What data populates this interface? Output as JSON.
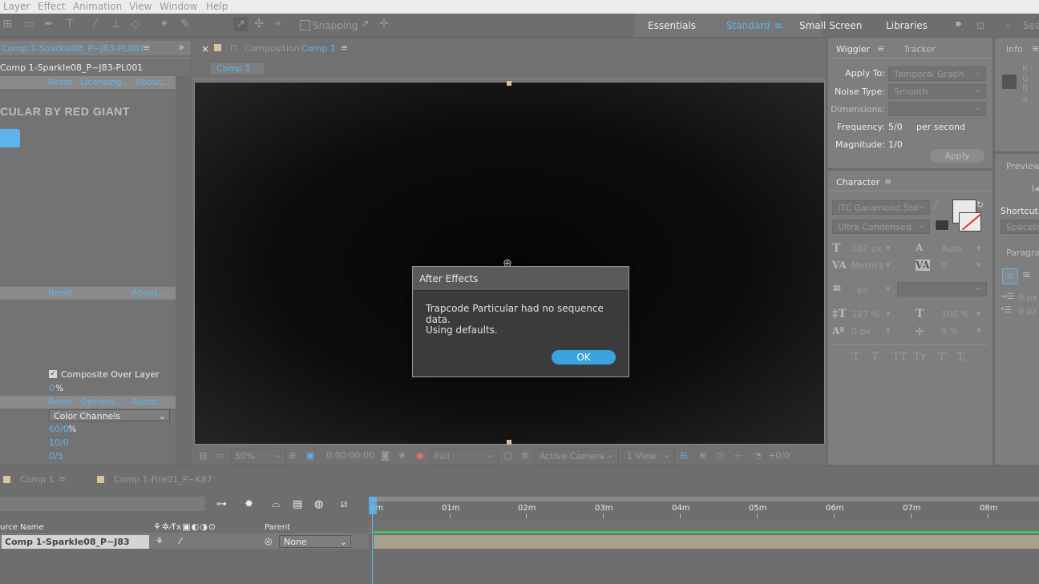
{
  "menu": [
    "Layer",
    "Effect",
    "Animation",
    "View",
    "Window",
    "Help"
  ],
  "toolbar": {
    "snapping_label": "Snapping"
  },
  "workspaces": [
    {
      "label": "Essentials",
      "active": false
    },
    {
      "label": "Standard",
      "active": true
    },
    {
      "label": "Small Screen",
      "active": false
    },
    {
      "label": "Libraries",
      "active": false
    }
  ],
  "effects_panel": {
    "tab_title": "Comp 1-Sparkle08_P~J83-PL001",
    "layer_title": "Comp 1-Sparkle08_P~J83-PL001",
    "row1": {
      "reset": "Reset",
      "licensing": "Licensing...",
      "about": "About..."
    },
    "brand": "CULAR BY RED GIANT",
    "row2": {
      "reset": "Reset",
      "about": "About..."
    },
    "composite_label": "Composite Over Layer",
    "composite_value": "0",
    "composite_unit": "%",
    "row3": {
      "reset": "Reset",
      "options": "Options...",
      "about": "About..."
    },
    "channels": "Color Channels",
    "val1": "60/0",
    "val1_unit": "%",
    "val2": "10/0",
    "val3": "0/5"
  },
  "composition": {
    "close": "×",
    "label": "Composition",
    "name": "Comp 1",
    "tab": "Comp 1",
    "zoom": "50%",
    "timecode": "0:00:00:00",
    "resolution": "Full",
    "camera": "Active Camera",
    "view": "1 View",
    "exposure": "+0/0"
  },
  "dialog": {
    "title": "After Effects",
    "line1": "Trapcode Particular had no sequence data.",
    "line2": "Using defaults.",
    "ok": "OK"
  },
  "wiggler": {
    "tab1": "Wiggler",
    "tab2": "Tracker",
    "apply_to_label": "Apply To:",
    "apply_to_value": "Temporal Graph",
    "noise_label": "Noise Type:",
    "noise_value": "Smooth",
    "dimensions_label": "Dimensions:",
    "frequency_label": "Frequency:",
    "frequency_value": "5/0",
    "frequency_unit": "per second",
    "magnitude_label": "Magnitude:",
    "magnitude_value": "1/0",
    "apply_button": "Apply"
  },
  "info_panel": {
    "tab": "Info",
    "r": "R :",
    "g": "G :",
    "b": "B :",
    "a": "A :",
    "preview": "Preview",
    "shortcut": "Shortcut",
    "shortcut_value": "Spaceba",
    "paragraph": "Paragrap",
    "indent1": "0 px",
    "indent2": "0 px"
  },
  "search_placeholder": "Sear",
  "character": {
    "tab": "Character",
    "font": "ITC Garamond Std",
    "style": "Ultra Condensed",
    "size": "102 px",
    "leading": "Auto",
    "kerning": "Metrics",
    "tracking": "0",
    "stroke": "- px",
    "vscale": "127 %",
    "hscale": "100 %",
    "baseline": "0 px",
    "tsume": "0 %",
    "styles": [
      "T",
      "T",
      "TT",
      "Tr",
      "T'",
      "T,"
    ]
  },
  "timeline": {
    "tab1": "Comp 1",
    "tab2": "Comp 1-Fire01_P~K87",
    "col_source": "urce Name",
    "col_parent": "Parent",
    "layer_name": "Comp 1-Sparkle08_P~J83",
    "parent_value": "None",
    "ruler": [
      "0m",
      "01m",
      "02m",
      "03m",
      "04m",
      "05m",
      "06m",
      "07m",
      "08m"
    ]
  }
}
